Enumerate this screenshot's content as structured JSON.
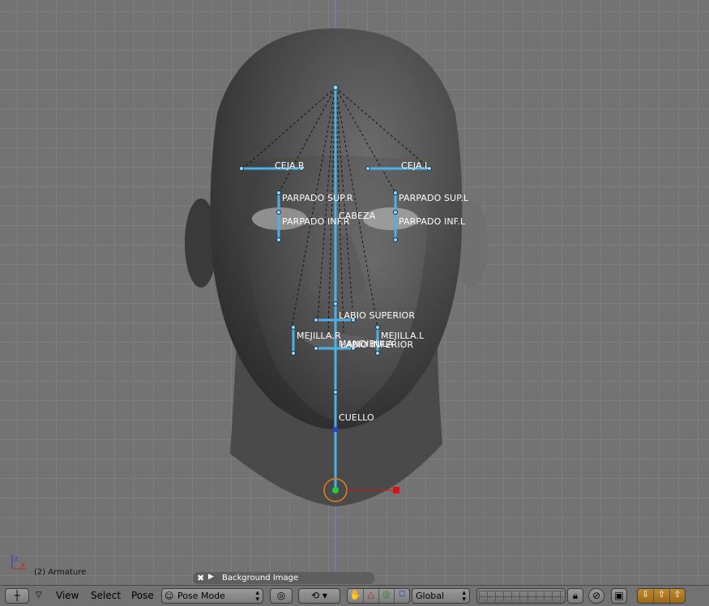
{
  "bones": {
    "ceja_r": "CEJA.R",
    "ceja_l": "CEJA.L",
    "parpado_sup_r": "PARPADO SUP.R",
    "parpado_sup_l": "PARPADO SUP.L",
    "cabeza": "CABEZA",
    "parpado_inf_r": "PARPADO INF.R",
    "parpado_inf_l": "PARPADO INF.L",
    "labio_superior": "LABIO SUPERIOR",
    "mejilla_r": "MEJILLA.R",
    "mejilla_l": "MEJILLA.L",
    "mandibula": "MANDIBULA",
    "labio_inferior": "LABIO INFERIOR",
    "cuello": "CUELLO"
  },
  "view_info": "(2) Armature",
  "background_panel": {
    "label": "Background Image",
    "close_icon": "x-icon",
    "expand_icon": "triangle-right-icon"
  },
  "header": {
    "menus": {
      "view": "View",
      "select": "Select",
      "pose": "Pose"
    },
    "mode": "Pose Mode",
    "orientation": "Global",
    "editor_icon": "viewport-crosshair-icon"
  },
  "colors": {
    "bone": "#4fb0e8",
    "viewport_bg": "#737373",
    "grid": "#7e7e7e",
    "header_bg": "#727272"
  }
}
